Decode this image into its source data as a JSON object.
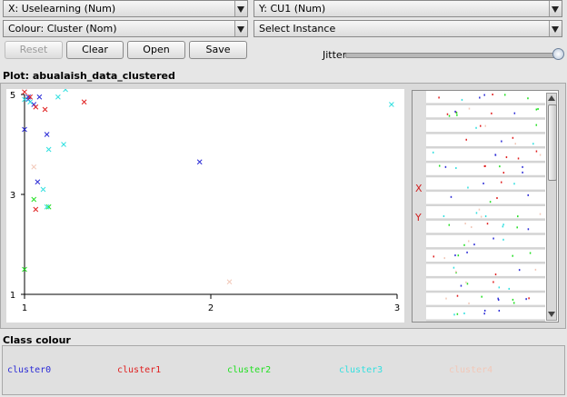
{
  "controls": {
    "x_axis": "X: Uselearning (Num)",
    "y_axis": "Y: CU1 (Num)",
    "colour": "Colour: Cluster (Nom)",
    "instance": "Select Instance",
    "reset": "Reset",
    "clear": "Clear",
    "open": "Open",
    "save": "Save",
    "jitter": "Jitter",
    "jitter_value": 1.0
  },
  "plot": {
    "title": "Plot: abualaish_data_clustered",
    "x_ticks": [
      "1",
      "2",
      "3"
    ],
    "y_ticks": [
      "5",
      "3",
      "1"
    ]
  },
  "side": {
    "x_marker": "X",
    "y_marker": "Y"
  },
  "class_colour": {
    "title": "Class colour",
    "items": [
      {
        "name": "cluster0",
        "color": "#2b2bd6"
      },
      {
        "name": "cluster1",
        "color": "#e02020"
      },
      {
        "name": "cluster2",
        "color": "#22e022"
      },
      {
        "name": "cluster3",
        "color": "#33e0e0"
      },
      {
        "name": "cluster4",
        "color": "#f2c8b8"
      }
    ]
  },
  "chart_data": {
    "type": "scatter",
    "title": "Plot: abualaish_data_clustered",
    "xlabel": "Uselearning",
    "ylabel": "CU1",
    "xlim": [
      1,
      3
    ],
    "ylim": [
      1,
      5
    ],
    "series": [
      {
        "name": "cluster0",
        "points": [
          [
            1.02,
            4.9
          ],
          [
            1.08,
            4.95
          ],
          [
            1.05,
            4.8
          ],
          [
            1.0,
            4.3
          ],
          [
            1.12,
            4.2
          ],
          [
            1.07,
            3.25
          ],
          [
            1.02,
            4.95
          ],
          [
            1.94,
            3.65
          ]
        ]
      },
      {
        "name": "cluster1",
        "points": [
          [
            1.0,
            5.05
          ],
          [
            1.06,
            4.75
          ],
          [
            1.11,
            4.7
          ],
          [
            1.03,
            4.95
          ],
          [
            1.32,
            4.85
          ],
          [
            1.06,
            2.7
          ]
        ]
      },
      {
        "name": "cluster2",
        "points": [
          [
            1.0,
            1.5
          ],
          [
            1.13,
            2.75
          ],
          [
            1.05,
            2.9
          ]
        ]
      },
      {
        "name": "cluster3",
        "points": [
          [
            1.0,
            4.9
          ],
          [
            1.22,
            5.1
          ],
          [
            1.18,
            4.95
          ],
          [
            1.13,
            3.9
          ],
          [
            1.21,
            4.0
          ],
          [
            1.1,
            3.1
          ],
          [
            1.12,
            2.75
          ],
          [
            2.97,
            4.8
          ],
          [
            1.03,
            4.85
          ]
        ]
      },
      {
        "name": "cluster4",
        "points": [
          [
            1.05,
            3.55
          ],
          [
            2.1,
            1.25
          ]
        ]
      }
    ]
  }
}
